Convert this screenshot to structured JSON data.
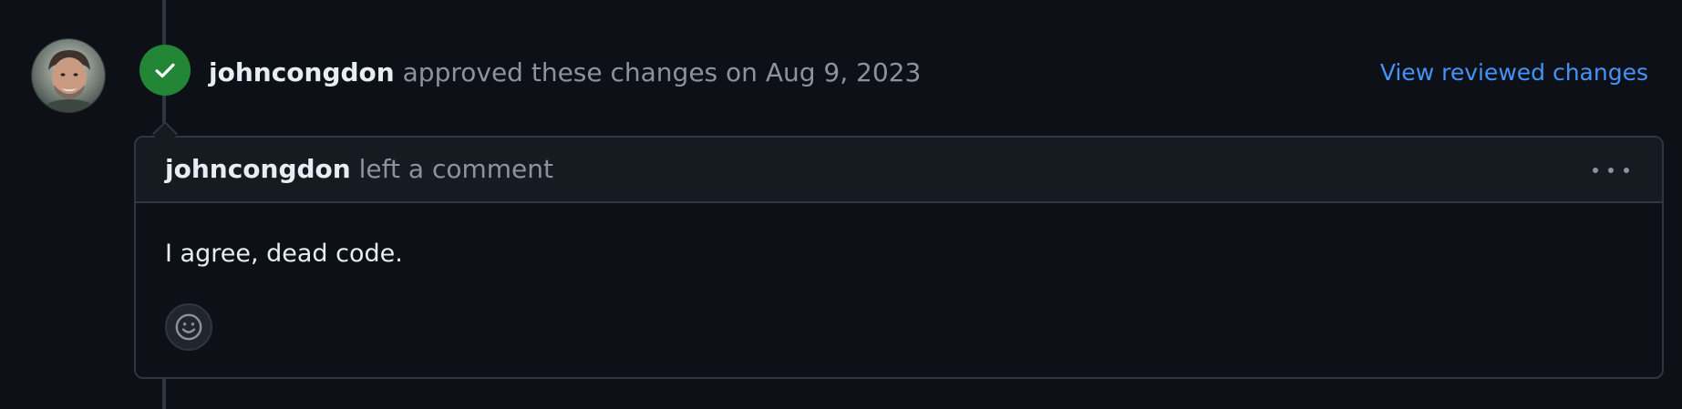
{
  "review_event": {
    "author": "johncongdon",
    "action_text": "approved these changes on Aug 9, 2023",
    "view_link_label": "View reviewed changes",
    "status_icon": "check-icon",
    "status_color": "#238636"
  },
  "comment": {
    "author": "johncongdon",
    "action_text": "left a comment",
    "body": "I agree, dead code.",
    "menu_icon": "kebab-horizontal-icon",
    "reaction_icon": "smiley-icon"
  },
  "colors": {
    "background": "#0d1117",
    "header_bg": "#161b22",
    "border": "#30363d",
    "link": "#4493f8",
    "muted": "#8b949e",
    "text": "#e6edf3"
  }
}
